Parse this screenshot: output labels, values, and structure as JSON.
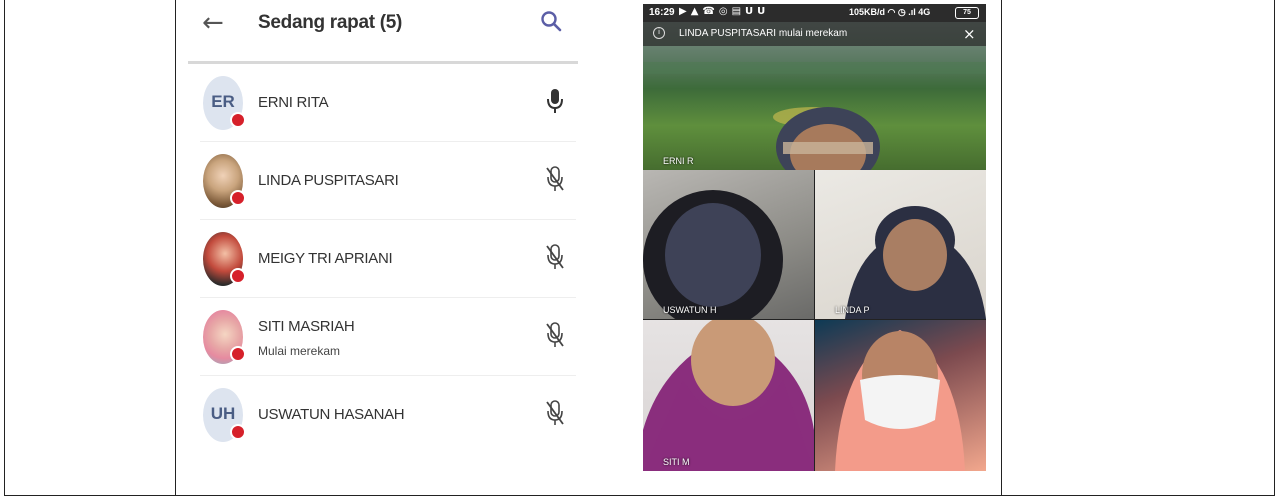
{
  "participants_panel": {
    "title": "Sedang rapat (5)",
    "back_icon": "arrow-left-icon",
    "search_icon": "search-icon",
    "participants": [
      {
        "name": "ERNI RITA",
        "initials": "ER",
        "subtitle": "",
        "mic": "mic-on-icon"
      },
      {
        "name": "LINDA PUSPITASARI",
        "initials": "",
        "subtitle": "",
        "mic": "mic-off-icon"
      },
      {
        "name": "MEIGY TRI APRIANI",
        "initials": "",
        "subtitle": "",
        "mic": "mic-off-icon"
      },
      {
        "name": "SITI MASRIAH",
        "initials": "",
        "subtitle": "Mulai merekam",
        "mic": "mic-off-icon"
      },
      {
        "name": "USWATUN HASANAH",
        "initials": "UH",
        "subtitle": "",
        "mic": "mic-off-icon"
      }
    ]
  },
  "video_call": {
    "status_bar": {
      "time": "16:29",
      "network": "105KB/d",
      "signal": "4G",
      "battery": "75"
    },
    "recording_banner": "LINDA PUSPITASARI mulai merekam",
    "tiles": [
      {
        "label": "ERNI R"
      },
      {
        "label": "USWATUN H"
      },
      {
        "label": "LINDA P"
      },
      {
        "label": "SITI M"
      },
      {
        "label": ""
      }
    ]
  },
  "colors": {
    "accent": "#5b5ea6",
    "record_dot": "#d6202a",
    "avatar_bg": "#dde4ef"
  }
}
